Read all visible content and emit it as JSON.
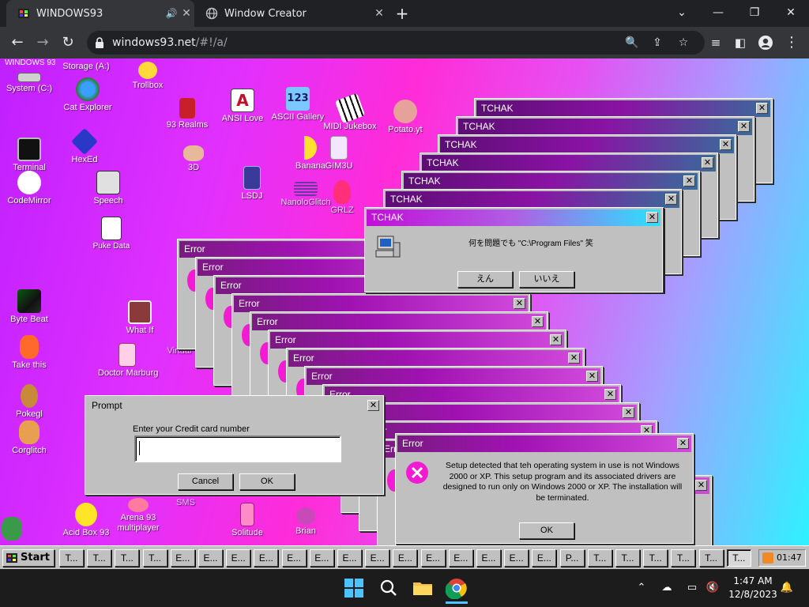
{
  "browser": {
    "tabs": [
      {
        "title": "WINDOWS93",
        "active": true
      },
      {
        "title": "Window Creator",
        "active": false
      }
    ],
    "url_host": "windows93.net",
    "url_path": "/#!/a/"
  },
  "desktop": {
    "title": "WINDOWS 93",
    "icons": [
      {
        "label": "Storage (A:)"
      },
      {
        "label": "System (C:)"
      },
      {
        "label": "Cat Explorer"
      },
      {
        "label": "Trollbox"
      },
      {
        "label": "93 Realms"
      },
      {
        "label": "ANSI Love"
      },
      {
        "label": "ASCII Gallery"
      },
      {
        "label": "MIDI Jukebox"
      },
      {
        "label": "Potato.yt"
      },
      {
        "label": "Terminal"
      },
      {
        "label": "HexEd"
      },
      {
        "label": "3D"
      },
      {
        "label": "Banana"
      },
      {
        "label": "GIM3U"
      },
      {
        "label": "CodeMirror"
      },
      {
        "label": "Speech"
      },
      {
        "label": "LSDJ"
      },
      {
        "label": "NanoloGlitch"
      },
      {
        "label": "GRLZ"
      },
      {
        "label": "Puke Data"
      },
      {
        "label": "Byte Beat"
      },
      {
        "label": "What If"
      },
      {
        "label": "Virtual"
      },
      {
        "label": "Take this"
      },
      {
        "label": "Doctor Marburg"
      },
      {
        "label": "Pokegl"
      },
      {
        "label": "Corglitch"
      },
      {
        "label": "Acid Box 93"
      },
      {
        "label": "Arena 93"
      },
      {
        "label": "multiplayer"
      },
      {
        "label": "SMS"
      },
      {
        "label": "Solitude"
      },
      {
        "label": "Brian"
      }
    ]
  },
  "tchak": {
    "title": "TCHAK",
    "message": "何を問題でも \"C:\\Program Files\" 笑",
    "yes_label": "えん",
    "no_label": "いいえ"
  },
  "error": {
    "title": "Error",
    "message": "Setup detected that teh operating system in use is not Windows 2000 or XP. This setup program and its associated drivers are designed to run only on Windows 2000 or XP. The installation will be terminated.",
    "ok_label": "OK"
  },
  "prompt": {
    "title": "Prompt",
    "label": "Enter your Credit card number",
    "value": "",
    "cancel_label": "Cancel",
    "ok_label": "OK"
  },
  "taskbar": {
    "start_label": "Start",
    "items": [
      "T...",
      "T...",
      "T...",
      "T...",
      "E...",
      "E...",
      "E...",
      "E...",
      "E...",
      "E...",
      "E...",
      "E...",
      "E...",
      "E...",
      "E...",
      "E...",
      "E...",
      "E...",
      "P...",
      "T...",
      "T...",
      "T...",
      "T...",
      "T...",
      "T..."
    ],
    "clock": "01:47"
  },
  "os_taskbar": {
    "time": "1:47 AM",
    "date": "12/8/2023"
  }
}
